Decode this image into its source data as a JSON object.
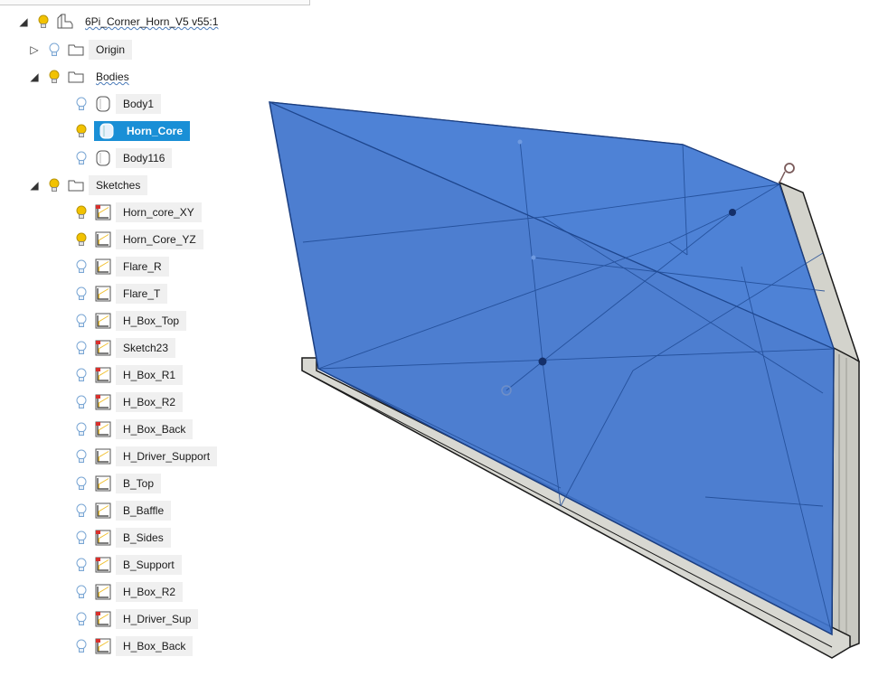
{
  "browser": {
    "root": {
      "label": "6Pi_Corner_Horn_V5 v55:1"
    },
    "origin": {
      "label": "Origin"
    },
    "bodies": {
      "label": "Bodies",
      "items": [
        {
          "label": "Body1",
          "light": false,
          "selected": false
        },
        {
          "label": "Horn_Core",
          "light": true,
          "selected": true
        },
        {
          "label": "Body116",
          "light": false,
          "selected": false
        }
      ]
    },
    "sketches": {
      "label": "Sketches",
      "items": [
        {
          "label": "Horn_core_XY",
          "light": true,
          "icon": "sketch-warning-icon"
        },
        {
          "label": "Horn_Core_YZ",
          "light": true,
          "icon": "sketch-icon"
        },
        {
          "label": "Flare_R",
          "light": false,
          "icon": "sketch-icon"
        },
        {
          "label": "Flare_T",
          "light": false,
          "icon": "sketch-icon"
        },
        {
          "label": "H_Box_Top",
          "light": false,
          "icon": "sketch-icon"
        },
        {
          "label": "Sketch23",
          "light": false,
          "icon": "sketch-warning-icon"
        },
        {
          "label": "H_Box_R1",
          "light": false,
          "icon": "sketch-warning-icon"
        },
        {
          "label": "H_Box_R2",
          "light": false,
          "icon": "sketch-warning-icon"
        },
        {
          "label": "H_Box_Back",
          "light": false,
          "icon": "sketch-warning-icon"
        },
        {
          "label": "H_Driver_Support",
          "light": false,
          "icon": "sketch-icon"
        },
        {
          "label": "B_Top",
          "light": false,
          "icon": "sketch-icon"
        },
        {
          "label": "B_Baffle",
          "light": false,
          "icon": "sketch-icon"
        },
        {
          "label": "B_Sides",
          "light": false,
          "icon": "sketch-warning-icon"
        },
        {
          "label": "B_Support",
          "light": false,
          "icon": "sketch-warning-icon"
        },
        {
          "label": "H_Box_R2",
          "light": false,
          "icon": "sketch-icon"
        },
        {
          "label": "H_Driver_Sup",
          "light": false,
          "icon": "sketch-warning-icon"
        },
        {
          "label": "H_Box_Back",
          "light": false,
          "icon": "sketch-warning-icon"
        }
      ]
    }
  },
  "colors": {
    "selection": "#1a8fd6",
    "body_blue": "#3d6fc9",
    "body_gray": "#d8d8d2",
    "bulb_on": "#f2c200",
    "bulb_off": "#8fb4d9"
  }
}
